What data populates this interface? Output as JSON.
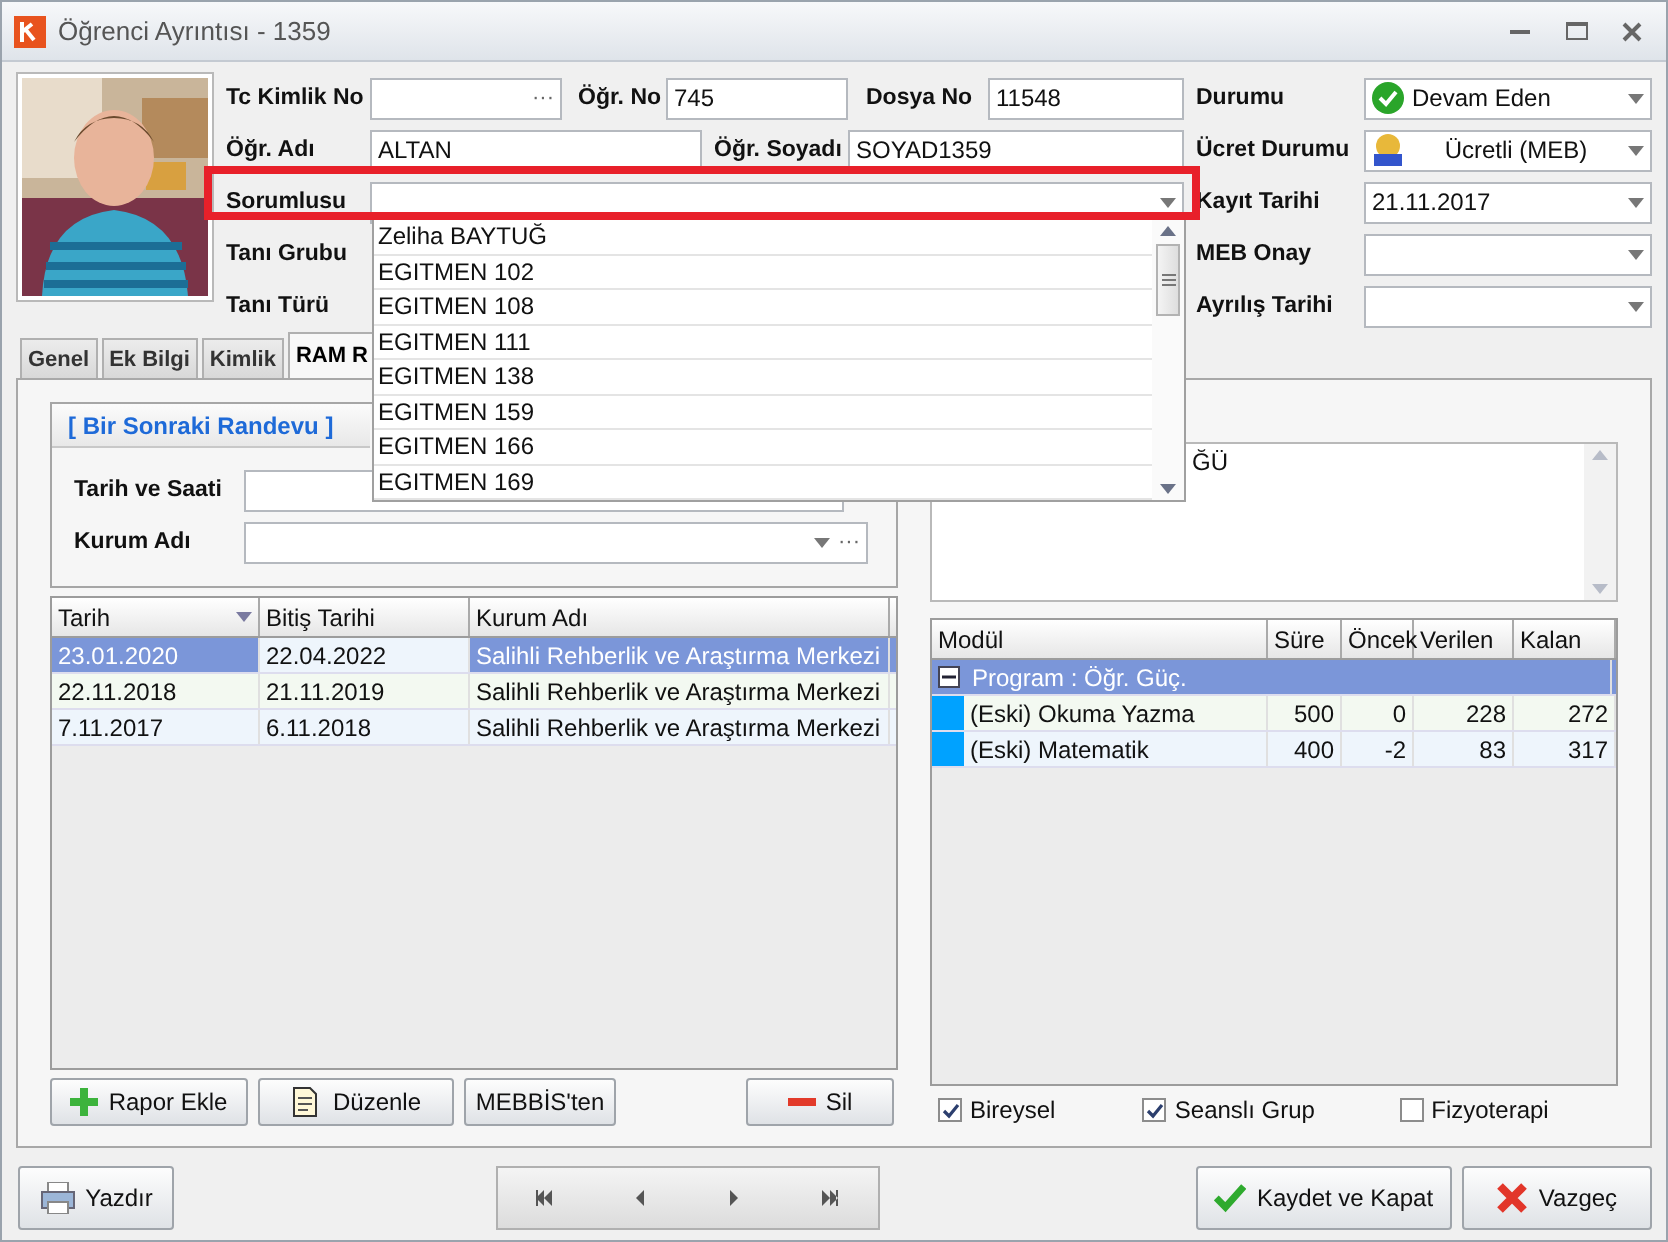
{
  "window": {
    "title": "Öğrenci Ayrıntısı - 1359"
  },
  "tc_kimlik_no": {
    "label": "Tc Kimlik No",
    "button": "···"
  },
  "ogr_no": {
    "label": "Öğr. No",
    "value": "745"
  },
  "dosya_no": {
    "label": "Dosya No",
    "value": "11548"
  },
  "durumu": {
    "label": "Durumu",
    "value": "Devam Eden"
  },
  "ogr_adi": {
    "label": "Öğr. Adı",
    "value": "ALTAN"
  },
  "ogr_soyadi": {
    "label": "Öğr. Soyadı",
    "value": "SOYAD1359"
  },
  "ucret_durumu": {
    "label": "Ücret Durumu",
    "value": "Ücretli (MEB)"
  },
  "sorumlusu": {
    "label": "Sorumlusu",
    "highlighted": true,
    "expanded": true
  },
  "kayit_tarihi": {
    "label": "Kayıt Tarihi",
    "value": "21.11.2017"
  },
  "tani_grubu": {
    "label": "Tanı Grubu"
  },
  "meb_onay": {
    "label": "MEB Onay"
  },
  "tani_turu": {
    "label": "Tanı Türü"
  },
  "ayrilis_tarihi": {
    "label": "Ayrılış Tarihi"
  },
  "dropdown_items": [
    "Zeliha BAYTUĞ",
    "EGITMEN 102",
    "EGITMEN 108",
    "EGITMEN 111",
    "EGITMEN 138",
    "EGITMEN 159",
    "EGITMEN 166",
    "EGITMEN 169"
  ],
  "tabs": [
    {
      "label": "Genel",
      "selected": false
    },
    {
      "label": "Ek Bilgi",
      "selected": false
    },
    {
      "label": "Kimlik",
      "selected": false
    },
    {
      "label": "RAM R",
      "selected": true
    }
  ],
  "appointment": {
    "title": "[ Bir Sonraki Randevu ]",
    "date_label": "Tarih ve Saati",
    "institution_label": "Kurum Adı",
    "institution_button": "···"
  },
  "reports": {
    "columns": [
      "Tarih",
      "Bitiş Tarihi",
      "Kurum Adı"
    ],
    "rows": [
      {
        "cells": [
          "23.01.2020",
          "22.04.2022",
          "Salihli Rehberlik ve Araştırma Merkezi"
        ],
        "selected": true
      },
      {
        "cells": [
          "22.11.2018",
          "21.11.2019",
          "Salihli Rehberlik ve Araştırma Merkezi"
        ],
        "selected": false
      },
      {
        "cells": [
          "7.11.2017",
          "6.11.2018",
          "Salihli Rehberlik ve Araştırma Merkezi"
        ],
        "selected": false
      }
    ]
  },
  "report_buttons": [
    {
      "label": "Rapor Ekle",
      "kind": "add"
    },
    {
      "label": "Düzenle",
      "kind": "edit"
    },
    {
      "label": "MEBBİS'ten",
      "kind": "plain"
    },
    {
      "label": "Sil",
      "kind": "delete"
    }
  ],
  "notes": {
    "text": "ĞÜ"
  },
  "modules": {
    "columns": [
      "Modül",
      "Süre",
      "Öncek",
      "Verilen",
      "Kalan"
    ],
    "group": {
      "label": "Program : Öğr. Güç.",
      "expanded": true
    },
    "rows": [
      {
        "cells": [
          "(Eski) Okuma Yazma",
          "500",
          "0",
          "228",
          "272"
        ]
      },
      {
        "cells": [
          "(Eski) Matematik",
          "400",
          "-2",
          "83",
          "317"
        ]
      }
    ]
  },
  "options": [
    {
      "label": "Bireysel",
      "checked": true
    },
    {
      "label": "Seanslı Grup",
      "checked": true
    },
    {
      "label": "Fizyoterapi",
      "checked": false
    }
  ],
  "print_button": "Yazdır",
  "save_button": "Kaydet ve Kapat",
  "cancel_button": "Vazgeç"
}
